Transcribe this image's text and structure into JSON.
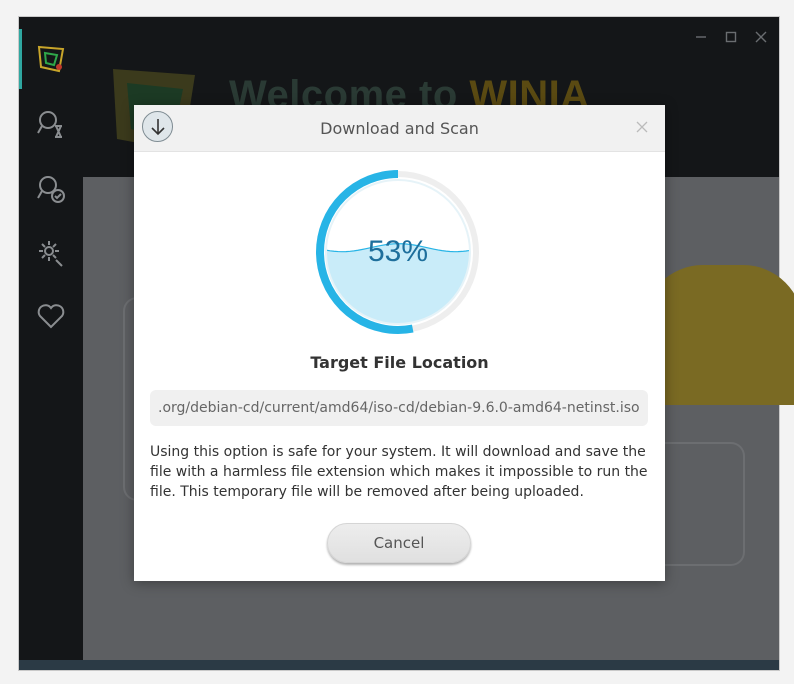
{
  "window": {
    "welcome_prefix": "Welcome to",
    "brand_name": "WINIA",
    "controls": [
      "minimize-icon",
      "maximize-icon",
      "close-icon"
    ]
  },
  "sidebar": {
    "items": [
      {
        "name": "app-logo-icon"
      },
      {
        "name": "scan-history-icon"
      },
      {
        "name": "scan-check-icon"
      },
      {
        "name": "settings-icon"
      },
      {
        "name": "favorites-icon"
      }
    ]
  },
  "dialog": {
    "title": "Download and Scan",
    "icon": "download-arrow-icon",
    "progress_value": 0.53,
    "progress_text": "53%",
    "section_label": "Target File Location",
    "file_path": ".org/debian-cd/current/amd64/iso-cd/debian-9.6.0-amd64-netinst.iso",
    "info_text": "Using this option is safe for your system. It will download and save the file with a harmless file extension  which makes it impossible to run the file. This temporary file will be removed after being uploaded.",
    "cancel_label": "Cancel"
  },
  "colors": {
    "progress_arc": "#27b4e6",
    "progress_fill": "#c9ecf9",
    "dialog_header": "#f1f1f1",
    "app_background": "#1e2124"
  }
}
